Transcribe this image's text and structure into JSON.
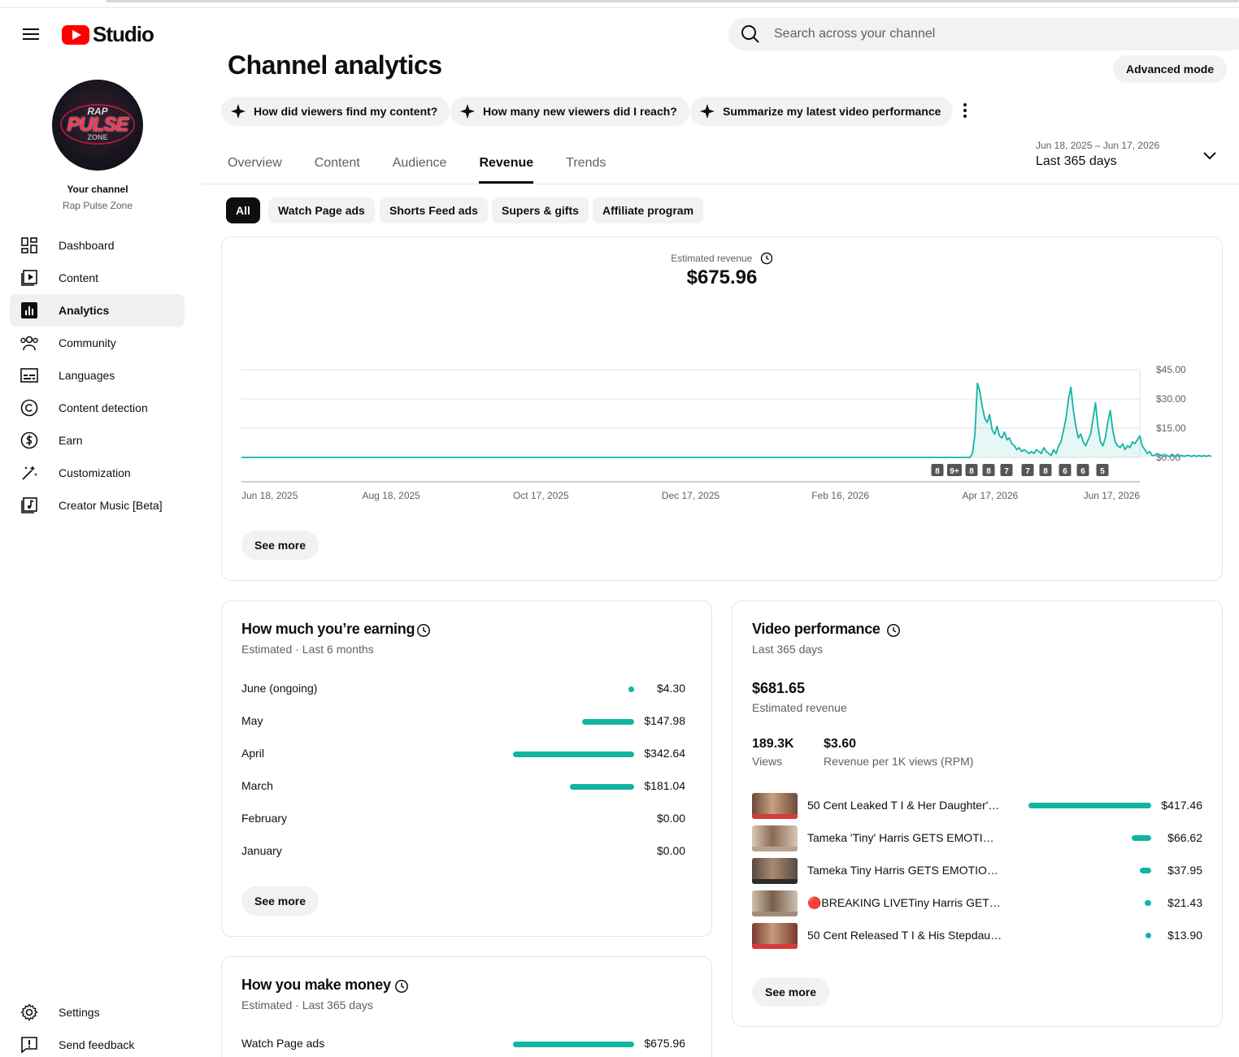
{
  "app": {
    "logo_text": "Studio"
  },
  "search": {
    "placeholder": "Search across your channel"
  },
  "channel": {
    "avatar_text": [
      "RAP",
      "PULSE",
      "ZONE"
    ],
    "your_channel_label": "Your channel",
    "name": "Rap Pulse Zone"
  },
  "sidebar": {
    "items": [
      {
        "label": "Dashboard",
        "icon": "dashboard-icon"
      },
      {
        "label": "Content",
        "icon": "content-icon"
      },
      {
        "label": "Analytics",
        "icon": "analytics-icon",
        "active": true
      },
      {
        "label": "Community",
        "icon": "community-icon"
      },
      {
        "label": "Languages",
        "icon": "subtitles-icon"
      },
      {
        "label": "Content detection",
        "icon": "copyright-icon"
      },
      {
        "label": "Earn",
        "icon": "dollar-icon"
      },
      {
        "label": "Customization",
        "icon": "magic-wand-icon"
      },
      {
        "label": "Creator Music [Beta]",
        "icon": "music-icon"
      }
    ],
    "bottom": [
      {
        "label": "Settings",
        "icon": "gear-icon"
      },
      {
        "label": "Send feedback",
        "icon": "feedback-icon"
      }
    ]
  },
  "page": {
    "title": "Channel analytics",
    "advanced_mode": "Advanced mode",
    "ask_chips": [
      "How did viewers find my content?",
      "How many new viewers did I reach?",
      "Summarize my latest video performance"
    ],
    "tabs": [
      "Overview",
      "Content",
      "Audience",
      "Revenue",
      "Trends"
    ],
    "active_tab": "Revenue",
    "date_range": {
      "dates": "Jun 18, 2025 – Jun 17, 2026",
      "label": "Last 365 days"
    },
    "filters": [
      "All",
      "Watch Page ads",
      "Shorts Feed ads",
      "Supers & gifts",
      "Affiliate program"
    ],
    "active_filter": "All"
  },
  "revenue_card": {
    "label": "Estimated revenue",
    "value": "$675.96",
    "see_more": "See more"
  },
  "chart_data": {
    "type": "area",
    "title": "",
    "xlabel": "",
    "ylabel": "",
    "y_tick_labels": [
      "$45.00",
      "$30.00",
      "$15.00",
      "$0.00"
    ],
    "ylim": [
      0,
      45
    ],
    "x_tick_labels": [
      "Jun 18, 2025",
      "Aug 18, 2025",
      "Oct 17, 2025",
      "Dec 17, 2025",
      "Feb 16, 2026",
      "Apr 17, 2026",
      "Jun 17, 2026"
    ],
    "x_days": 365,
    "series": [
      {
        "values_start_day": 0,
        "values": [
          0,
          0,
          0,
          0,
          0,
          0,
          0,
          0,
          0,
          0,
          0,
          0,
          0,
          0,
          0,
          0,
          0,
          0,
          0,
          0,
          0,
          0,
          0,
          0,
          0,
          0,
          0,
          0,
          0,
          0,
          0,
          0,
          0,
          0,
          0,
          0,
          0,
          0,
          0,
          0,
          0,
          0,
          0,
          0,
          0,
          0,
          0,
          0,
          0,
          0,
          0,
          0,
          0,
          0,
          0,
          0,
          0,
          0,
          0,
          0,
          0,
          0,
          0,
          0,
          0,
          0,
          0,
          0,
          0,
          0,
          0,
          0,
          0,
          0,
          0,
          0,
          0,
          0,
          0,
          0,
          0,
          0,
          0,
          0,
          0,
          0,
          0,
          0,
          0,
          0,
          0,
          0,
          0,
          0,
          0,
          0,
          0,
          0,
          0,
          0,
          0,
          0,
          0,
          0,
          0,
          0,
          0,
          0,
          0,
          0,
          0,
          0,
          0,
          0,
          0,
          0,
          0,
          0,
          0,
          0,
          0,
          0,
          0,
          0,
          0,
          0,
          0,
          0,
          0,
          0,
          0,
          0,
          0,
          0,
          0,
          0,
          0,
          0,
          0,
          0,
          0,
          0,
          0,
          0,
          0,
          0,
          0,
          0,
          0,
          0,
          0,
          0,
          0,
          0,
          0,
          0,
          0,
          0,
          0,
          0,
          0,
          0,
          0,
          0,
          0,
          0,
          0,
          0,
          0,
          0,
          0,
          0,
          0,
          0,
          0,
          0,
          0,
          0,
          0,
          0,
          0,
          0,
          0,
          0,
          0,
          0,
          0,
          0,
          0,
          0,
          0,
          0,
          0,
          0,
          0,
          0,
          0,
          0,
          0,
          0,
          0,
          0,
          0,
          0,
          0,
          0,
          0,
          0,
          0,
          0,
          0,
          0,
          0,
          0,
          0,
          0,
          0,
          0,
          0,
          0,
          0,
          0,
          0,
          0,
          0,
          0,
          0,
          0,
          0,
          0,
          0,
          0,
          0,
          0,
          0,
          0,
          0,
          0,
          0,
          0,
          0,
          0,
          0,
          0,
          0,
          0,
          0,
          0,
          0,
          0,
          0,
          0,
          0,
          0,
          0,
          0,
          0,
          0,
          0,
          0,
          0,
          0,
          0,
          0,
          0,
          0,
          0,
          0,
          0,
          0,
          0,
          0,
          0,
          0,
          0,
          0,
          0,
          0,
          0,
          0,
          0,
          0,
          0,
          0,
          0,
          0,
          0,
          0,
          0,
          0,
          0,
          0,
          0,
          0,
          0,
          0,
          0,
          2,
          12,
          38,
          34,
          26,
          20,
          18,
          22,
          14,
          12,
          16,
          11,
          10,
          13,
          9,
          10,
          7,
          6,
          4,
          5,
          3,
          4,
          3,
          2,
          3,
          2,
          4,
          3,
          2,
          5,
          3,
          2,
          1,
          4,
          2,
          6,
          8,
          14,
          20,
          30,
          36,
          24,
          16,
          10,
          12,
          8,
          6,
          9,
          12,
          20,
          28,
          16,
          8,
          6,
          10,
          18,
          24,
          14,
          8,
          6,
          5,
          7,
          4,
          6,
          5,
          8,
          7,
          9,
          11,
          6,
          4,
          2,
          3,
          1,
          1,
          2,
          1,
          1,
          0.5,
          1,
          0.5,
          1,
          0.5,
          1,
          0.5,
          1,
          0.5,
          1,
          1,
          0.5,
          1,
          0.5,
          1,
          0.5,
          1,
          0.5,
          1,
          0.5
        ]
      }
    ],
    "annotation_badges": [
      "8",
      "9+",
      "8",
      "8",
      "7",
      "7",
      "8",
      "6",
      "6",
      "5"
    ]
  },
  "earning_card": {
    "title": "How much you’re earning",
    "subtitle": "Estimated · Last 6 months",
    "max": 342.64,
    "rows": [
      {
        "month": "June (ongoing)",
        "value": 4.3,
        "label": "$4.30"
      },
      {
        "month": "May",
        "value": 147.98,
        "label": "$147.98"
      },
      {
        "month": "April",
        "value": 342.64,
        "label": "$342.64"
      },
      {
        "month": "March",
        "value": 181.04,
        "label": "$181.04"
      },
      {
        "month": "February",
        "value": 0,
        "label": "$0.00"
      },
      {
        "month": "January",
        "value": 0,
        "label": "$0.00"
      }
    ],
    "see_more": "See more"
  },
  "money_card": {
    "title": "How you make money",
    "subtitle": "Estimated · Last 365 days",
    "rows": [
      {
        "source": "Watch Page ads",
        "value": 675.96,
        "label": "$675.96",
        "fraction": 1
      }
    ]
  },
  "video_card": {
    "title": "Video performance",
    "subtitle": "Last 365 days",
    "revenue": "$681.65",
    "revenue_label": "Estimated revenue",
    "views": "189.3K",
    "views_label": "Views",
    "rpm": "$3.60",
    "rpm_label": "Revenue per 1K views (RPM)",
    "max": 417.46,
    "videos": [
      {
        "title": "50 Cent Leaked T I & Her Daughter's ...",
        "value": 417.46,
        "label": "$417.46"
      },
      {
        "title": "Tameka 'Tiny' Harris GETS EMOTION...",
        "value": 66.62,
        "label": "$66.62"
      },
      {
        "title": "Tameka Tiny Harris GETS EMOTION...",
        "value": 37.95,
        "label": "$37.95"
      },
      {
        "title": "🔴BREAKING LIVETiny Harris GETS ...",
        "value": 21.43,
        "label": "$21.43"
      },
      {
        "title": "50 Cent Released T I & His Stepdaug...",
        "value": 13.9,
        "label": "$13.90"
      }
    ],
    "see_more": "See more"
  },
  "colors": {
    "accent": "#12b5a2",
    "brand": "#ff0000",
    "active_chip": "#0f0f0f"
  }
}
